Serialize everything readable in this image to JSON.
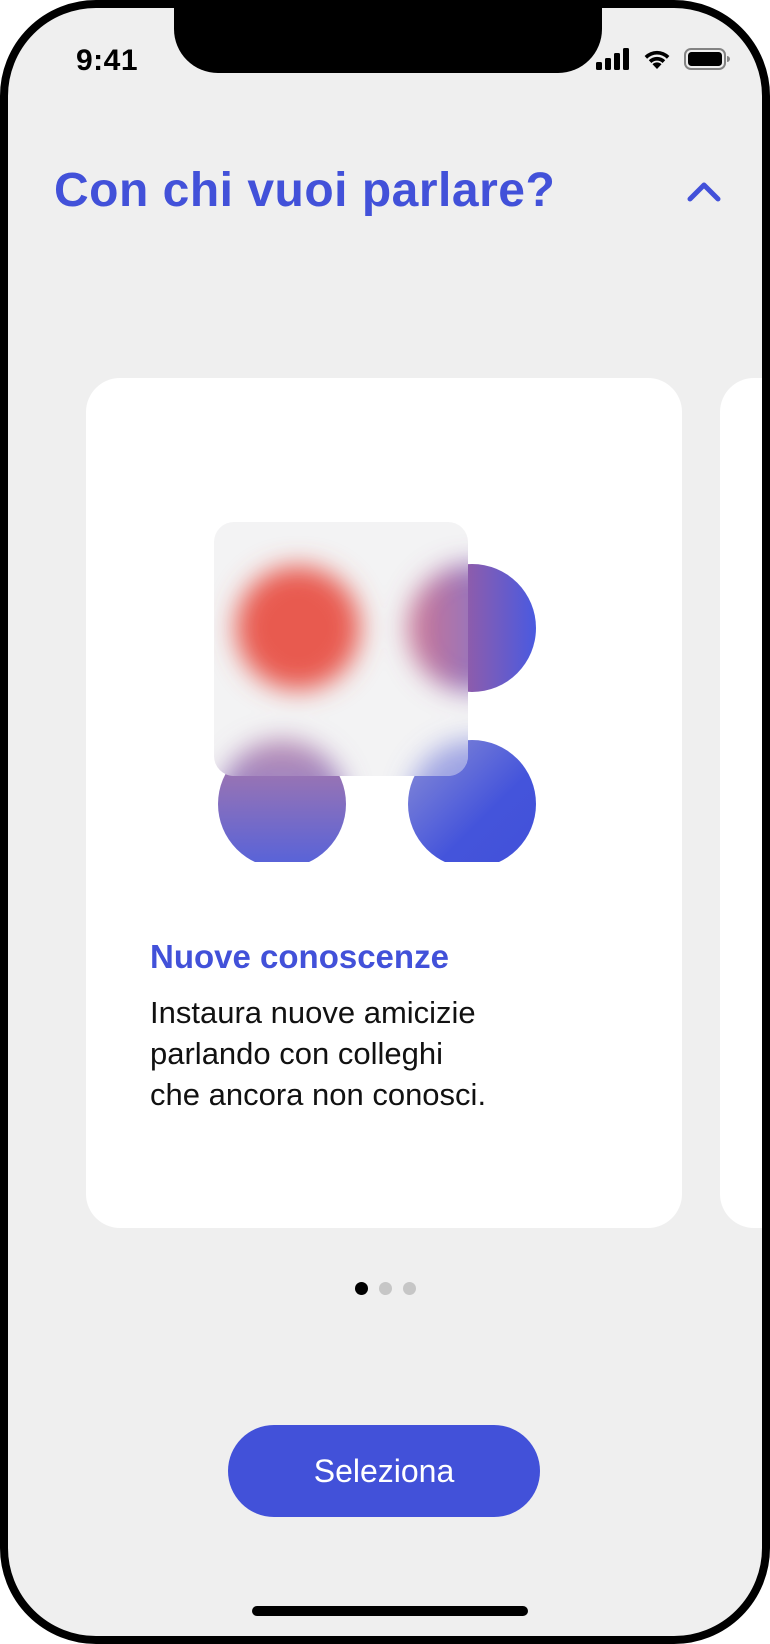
{
  "status_bar": {
    "time": "9:41",
    "icons": [
      "cellular-signal-icon",
      "wifi-icon",
      "battery-icon"
    ]
  },
  "header": {
    "title": "Con chi vuoi parlare?",
    "toggle_icon": "chevron-up-icon"
  },
  "carousel": {
    "active_index": 0,
    "total": 3,
    "cards": [
      {
        "heading": "Nuove conoscenze",
        "body_lines": [
          "Instaura nuove amicizie",
          "parlando con colleghi",
          "che ancora non conosci."
        ]
      }
    ]
  },
  "action": {
    "button_label": "Seleziona"
  },
  "colors": {
    "accent": "#4251d9",
    "red": "#e85a4f",
    "background": "#efefef",
    "card": "#ffffff"
  }
}
